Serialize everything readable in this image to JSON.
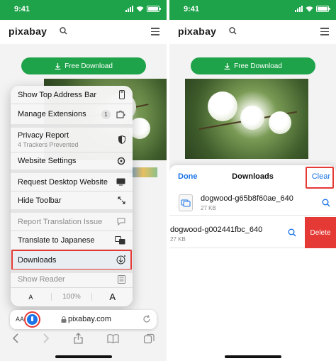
{
  "status": {
    "time": "9:41"
  },
  "site": {
    "logo": "pixabay",
    "download_label": "Free Download",
    "url": "pixabay.com"
  },
  "menu": {
    "items": [
      {
        "label": "Show Top Address Bar"
      },
      {
        "label": "Manage Extensions",
        "badge": "1"
      },
      {
        "label": "Privacy Report",
        "sublabel": "4 Trackers Prevented"
      },
      {
        "label": "Website Settings"
      },
      {
        "label": "Request Desktop Website"
      },
      {
        "label": "Hide Toolbar"
      },
      {
        "label": "Report Translation Issue"
      },
      {
        "label": "Translate to Japanese"
      },
      {
        "label": "Downloads"
      },
      {
        "label": "Show Reader"
      }
    ],
    "zoom": {
      "small_a": "A",
      "percent": "100%",
      "large_a": "A"
    }
  },
  "address": {
    "aa": "AA"
  },
  "downloads": {
    "done": "Done",
    "title": "Downloads",
    "clear": "Clear",
    "files": [
      {
        "name": "dogwood-g65b8f60ae_640",
        "size": "27 KB"
      },
      {
        "name": "dogwood-g002441fbc_640",
        "size": "27 KB"
      }
    ],
    "delete": "Delete"
  },
  "colors": {
    "brand_green": "#1fa34a",
    "accent_red": "#e53935",
    "link_blue": "#1a73e8"
  }
}
